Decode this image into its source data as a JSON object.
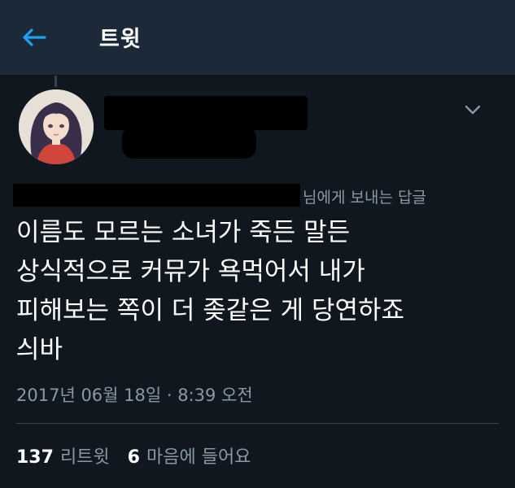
{
  "header": {
    "title": "트윗",
    "back_icon": "arrow-left-icon",
    "accent_color": "#1da1f2"
  },
  "tweet": {
    "reply_label": "님에게 보내는 답글",
    "text": "이름도 모르는 소녀가 죽든 말든\n상식적으로 커뮤가 욕먹어서 내가\n피해보는 쪽이 더 좆같은 게 당연하죠\n싀바",
    "timestamp": "2017년 06월 18일 · 8:39 오전",
    "menu_icon": "chevron-down-icon"
  },
  "stats": {
    "retweets_count": "137",
    "retweets_label": "리트윗",
    "likes_count": "6",
    "likes_label": "마음에 들어요"
  }
}
